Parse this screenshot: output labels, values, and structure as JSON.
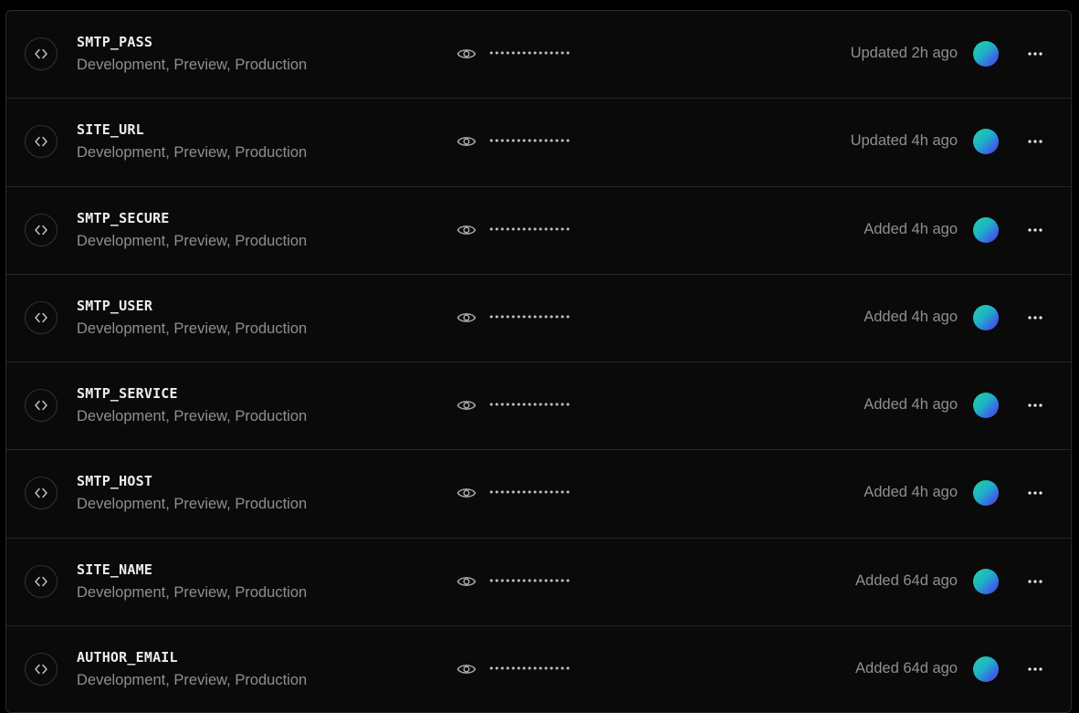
{
  "env_vars": [
    {
      "name": "SMTP_PASS",
      "environments": "Development, Preview, Production",
      "masked_value": "•••••••••••••••",
      "status": "Updated 2h ago"
    },
    {
      "name": "SITE_URL",
      "environments": "Development, Preview, Production",
      "masked_value": "•••••••••••••••",
      "status": "Updated 4h ago"
    },
    {
      "name": "SMTP_SECURE",
      "environments": "Development, Preview, Production",
      "masked_value": "•••••••••••••••",
      "status": "Added 4h ago"
    },
    {
      "name": "SMTP_USER",
      "environments": "Development, Preview, Production",
      "masked_value": "•••••••••••••••",
      "status": "Added 4h ago"
    },
    {
      "name": "SMTP_SERVICE",
      "environments": "Development, Preview, Production",
      "masked_value": "•••••••••••••••",
      "status": "Added 4h ago"
    },
    {
      "name": "SMTP_HOST",
      "environments": "Development, Preview, Production",
      "masked_value": "•••••••••••••••",
      "status": "Added 4h ago"
    },
    {
      "name": "SITE_NAME",
      "environments": "Development, Preview, Production",
      "masked_value": "•••••••••••••••",
      "status": "Added 64d ago"
    },
    {
      "name": "AUTHOR_EMAIL",
      "environments": "Development, Preview, Production",
      "masked_value": "•••••••••••••••",
      "status": "Added 64d ago"
    }
  ],
  "icons": {
    "type": "code-brackets-icon",
    "reveal": "eye-icon",
    "menu": "more-horizontal-icon"
  },
  "colors": {
    "background": "#0a0a0a",
    "border": "#262626",
    "name_text": "#ededed",
    "muted_text": "#8f8f8f"
  }
}
